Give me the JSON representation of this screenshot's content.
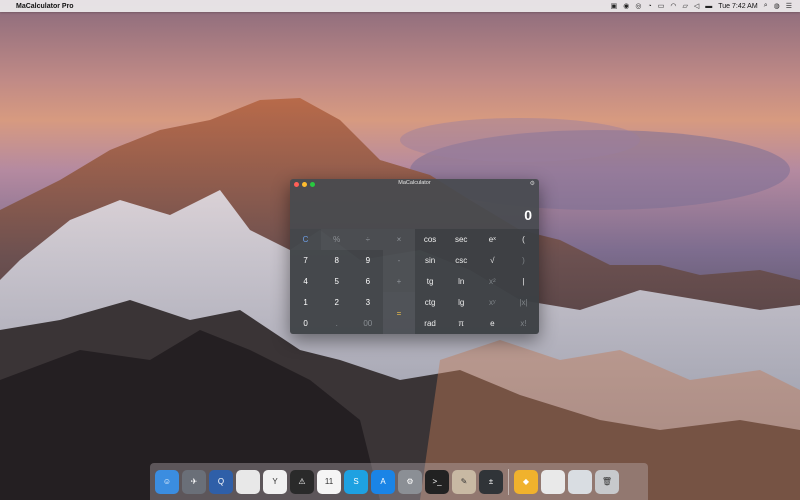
{
  "menubar": {
    "app_name": "MaCalculator Pro",
    "time": "Tue 7:42 AM"
  },
  "window": {
    "title": "MaCalculator",
    "display_value": "0"
  },
  "keys": [
    {
      "label": "C",
      "kind": "clear"
    },
    {
      "label": "%",
      "kind": "op"
    },
    {
      "label": "÷",
      "kind": "op"
    },
    {
      "label": "×",
      "kind": "op"
    },
    {
      "label": "cos",
      "kind": "fn"
    },
    {
      "label": "sec",
      "kind": "fn"
    },
    {
      "label": "eˣ",
      "kind": "fn"
    },
    {
      "label": "(",
      "kind": "fn"
    },
    {
      "label": "7",
      "kind": "num"
    },
    {
      "label": "8",
      "kind": "num"
    },
    {
      "label": "9",
      "kind": "num"
    },
    {
      "label": "-",
      "kind": "op"
    },
    {
      "label": "sin",
      "kind": "fn"
    },
    {
      "label": "csc",
      "kind": "fn"
    },
    {
      "label": "√",
      "kind": "fn"
    },
    {
      "label": ")",
      "kind": "fn-dim"
    },
    {
      "label": "4",
      "kind": "num"
    },
    {
      "label": "5",
      "kind": "num"
    },
    {
      "label": "6",
      "kind": "num"
    },
    {
      "label": "+",
      "kind": "op"
    },
    {
      "label": "tg",
      "kind": "fn"
    },
    {
      "label": "ln",
      "kind": "fn"
    },
    {
      "label": "x²",
      "kind": "fn-dim"
    },
    {
      "label": "|",
      "kind": "fn"
    },
    {
      "label": "1",
      "kind": "num"
    },
    {
      "label": "2",
      "kind": "num"
    },
    {
      "label": "3",
      "kind": "num"
    },
    {
      "label": "=",
      "kind": "equals"
    },
    {
      "label": "ctg",
      "kind": "fn"
    },
    {
      "label": "lg",
      "kind": "fn"
    },
    {
      "label": "xʸ",
      "kind": "fn-dim"
    },
    {
      "label": "|x|",
      "kind": "fn-dim"
    },
    {
      "label": "0",
      "kind": "num"
    },
    {
      "label": ".",
      "kind": "zero-dim"
    },
    {
      "label": "00",
      "kind": "zero-dim"
    },
    {
      "label": "rad",
      "kind": "fn"
    },
    {
      "label": "π",
      "kind": "fn"
    },
    {
      "label": "e",
      "kind": "fn"
    },
    {
      "label": "x!",
      "kind": "fn-dim"
    }
  ],
  "dock": [
    {
      "name": "finder",
      "color": "#3b8de0",
      "glyph": "☺"
    },
    {
      "name": "launchpad",
      "color": "#6a6f78",
      "glyph": "✈"
    },
    {
      "name": "quicktime",
      "color": "#2f5fa8",
      "glyph": "Q"
    },
    {
      "name": "textedit",
      "color": "#e8e8e8",
      "glyph": ""
    },
    {
      "name": "yandex-browser",
      "color": "#f1f1f1",
      "glyph": "Y"
    },
    {
      "name": "console",
      "color": "#2a2a2a",
      "glyph": "⚠"
    },
    {
      "name": "calendar",
      "color": "#f5f5f5",
      "glyph": "11"
    },
    {
      "name": "skype",
      "color": "#1ea1e1",
      "glyph": "S"
    },
    {
      "name": "app-store",
      "color": "#1a84e6",
      "glyph": "A"
    },
    {
      "name": "system-preferences",
      "color": "#8b8f95",
      "glyph": "⚙"
    },
    {
      "name": "terminal",
      "color": "#222222",
      "glyph": ">_"
    },
    {
      "name": "script-editor",
      "color": "#c8b9a3",
      "glyph": "✎"
    },
    {
      "name": "macalculator",
      "color": "#303438",
      "glyph": "±"
    },
    {
      "name": "sep",
      "color": "",
      "glyph": ""
    },
    {
      "name": "sketch",
      "color": "#f0b22d",
      "glyph": "◆"
    },
    {
      "name": "finder-window",
      "color": "#e9e9e9",
      "glyph": ""
    },
    {
      "name": "preview",
      "color": "#d9dde2",
      "glyph": ""
    },
    {
      "name": "trash",
      "color": "#c7c9cc",
      "glyph": "🗑"
    }
  ]
}
